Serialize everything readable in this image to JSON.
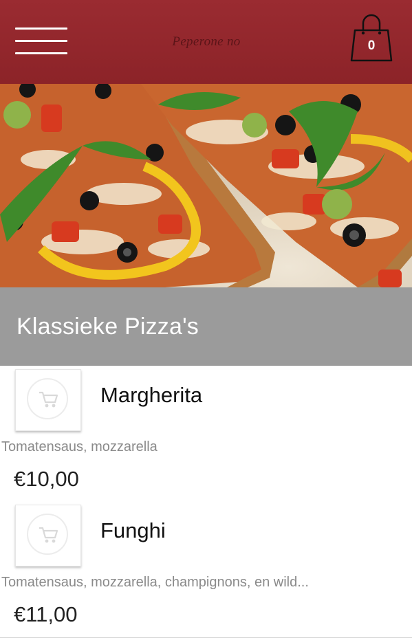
{
  "header": {
    "logo_text": "Peperone no",
    "cart_count": "0",
    "colors": {
      "brand": "#8f252a",
      "category_bar": "#9b9b9b"
    }
  },
  "hero": {
    "image": "pizza slices with arugula, peppers and olives"
  },
  "category": {
    "title": "Klassieke Pizza's"
  },
  "products": [
    {
      "name": "Margherita",
      "description": "Tomatensaus, mozzarella",
      "price": "€10,00",
      "icon": "cart-icon"
    },
    {
      "name": "Funghi",
      "description": "Tomatensaus, mozzarella, champignons, en wild...",
      "price": "€11,00",
      "icon": "cart-icon"
    }
  ]
}
